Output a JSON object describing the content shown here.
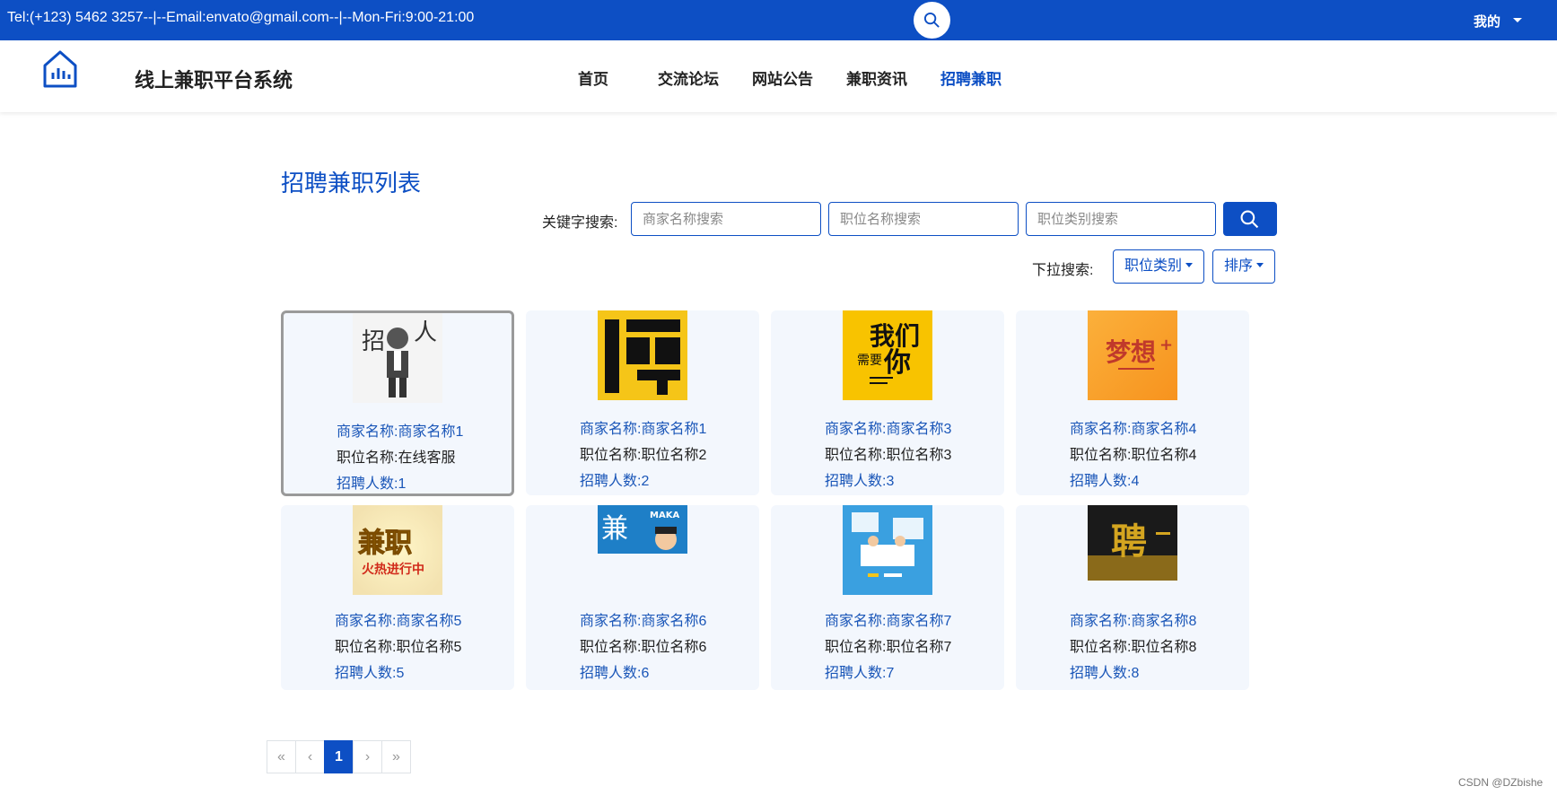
{
  "topbar": {
    "contact": "Tel:(+123) 5462 3257--|--Email:envato@gmail.com--|--Mon-Fri:9:00-21:00",
    "me_label": "我的"
  },
  "nav": {
    "site_title": "线上兼职平台系统",
    "items": [
      {
        "label": "首页"
      },
      {
        "label": "交流论坛"
      },
      {
        "label": "网站公告"
      },
      {
        "label": "兼职资讯"
      },
      {
        "label": "招聘兼职",
        "active": true
      }
    ]
  },
  "main": {
    "title": "招聘兼职列表",
    "keyword_label": "关键字搜索:",
    "search": {
      "merchant_placeholder": "商家名称搜索",
      "position_placeholder": "职位名称搜索",
      "category_placeholder": "职位类别搜索"
    },
    "dropdown_label": "下拉搜索:",
    "category_button": "职位类别",
    "sort_button": "排序"
  },
  "cards": [
    {
      "merchant": "商家名称:商家名称1",
      "position": "职位名称:在线客服",
      "count": "招聘人数:1",
      "image": "cartoon-recruiter",
      "selected": true
    },
    {
      "merchant": "商家名称:商家名称1",
      "position": "职位名称:职位名称2",
      "count": "招聘人数:2",
      "image": "pin-poster-black-yellow"
    },
    {
      "merchant": "商家名称:商家名称3",
      "position": "职位名称:职位名称3",
      "count": "招聘人数:3",
      "image": "we-need-you-poster"
    },
    {
      "merchant": "商家名称:商家名称4",
      "position": "职位名称:职位名称4",
      "count": "招聘人数:4",
      "image": "dream-plus-poster"
    },
    {
      "merchant": "商家名称:商家名称5",
      "position": "职位名称:职位名称5",
      "count": "招聘人数:5",
      "image": "part-time-hot-poster"
    },
    {
      "merchant": "商家名称:商家名称6",
      "position": "职位名称:职位名称6",
      "count": "招聘人数:6",
      "image": "maka-jian-banner"
    },
    {
      "merchant": "商家名称:商家名称7",
      "position": "职位名称:职位名称7",
      "count": "招聘人数:7",
      "image": "office-illustration"
    },
    {
      "merchant": "商家名称:商家名称8",
      "position": "职位名称:职位名称8",
      "count": "招聘人数:8",
      "image": "gold-pin-dark"
    }
  ],
  "pagination": {
    "first": "«",
    "prev": "‹",
    "current": "1",
    "next": "›",
    "last": "»"
  },
  "watermark": "CSDN @DZbishe",
  "colors": {
    "primary": "#0d4fc4",
    "card_bg": "#f3f7fd"
  }
}
